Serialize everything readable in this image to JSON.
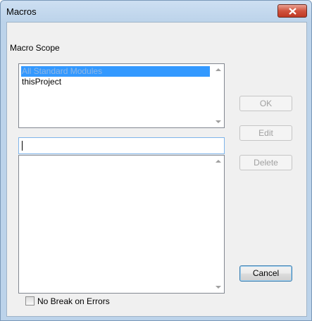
{
  "window": {
    "title": "Macros"
  },
  "scope": {
    "label": "Macro Scope",
    "items": [
      {
        "label": "All Standard Modules",
        "selected": true
      },
      {
        "label": "thisProject",
        "selected": false
      }
    ]
  },
  "macro_name": {
    "value": ""
  },
  "macros_list": {
    "items": []
  },
  "buttons": {
    "ok": "OK",
    "edit": "Edit",
    "delete": "Delete",
    "cancel": "Cancel"
  },
  "options": {
    "no_break_label": "No Break on Errors",
    "no_break_checked": false
  }
}
